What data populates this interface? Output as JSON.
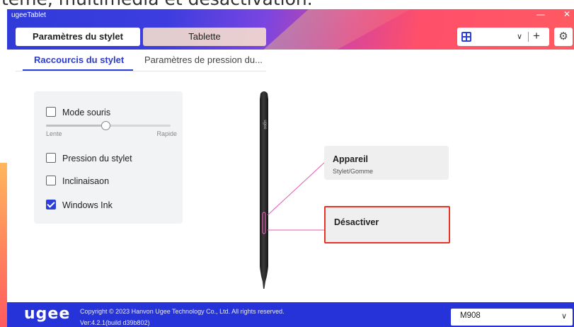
{
  "caption_text": "tème, multimédia et désactivation.",
  "window": {
    "title": "ugeeTablet",
    "minimize_glyph": "—",
    "close_glyph": "✕"
  },
  "main_tabs": [
    {
      "label": "Paramètres du stylet",
      "active": true
    },
    {
      "label": "Tablette",
      "active": false
    }
  ],
  "toolbar": {
    "device_icon": "grid-icon",
    "chevron_glyph": "∨",
    "add_glyph": "+",
    "settings_icon": "gear-icon",
    "settings_glyph": "⚙"
  },
  "sub_tabs": [
    {
      "label": "Raccourcis du stylet",
      "active": true
    },
    {
      "label": "Paramètres de pression du...",
      "active": false
    }
  ],
  "options": {
    "mode_souris": {
      "label": "Mode souris",
      "checked": false
    },
    "speed_slider": {
      "min_label": "Lente",
      "max_label": "Rapide",
      "value_fraction": 0.48
    },
    "pression": {
      "label": "Pression du stylet",
      "checked": false
    },
    "inclinaison": {
      "label": "Inclinaisaon",
      "checked": false
    },
    "windows_ink": {
      "label": "Windows Ink",
      "checked": true
    }
  },
  "pen": {
    "brand_text": "ugee"
  },
  "cards": {
    "appareil": {
      "title": "Appareil",
      "subtitle": "Stylet/Gomme"
    },
    "desactiver": {
      "title": "Désactiver"
    }
  },
  "colors": {
    "accent": "#2c3fd6",
    "highlight_border": "#e8332a",
    "connector": "#e65ab0"
  },
  "footer": {
    "logo": "ugee",
    "copyright": "Copyright © 2023 Hanvon Ugee Technology Co., Ltd. All rights reserved.",
    "version": "Ver:4.2.1(build d39b802)",
    "model": "M908",
    "model_chevron": "∨"
  }
}
